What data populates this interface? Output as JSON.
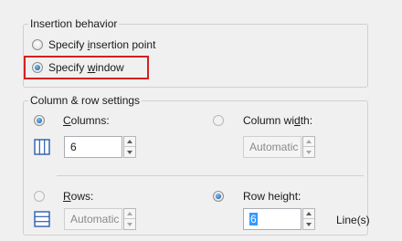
{
  "insertion_behavior": {
    "title": "Insertion behavior",
    "options": [
      {
        "label_pre": "Specify ",
        "label_u": "i",
        "label_post": "nsertion point",
        "checked": false
      },
      {
        "label_pre": "Specify ",
        "label_u": "w",
        "label_post": "indow",
        "checked": true
      }
    ]
  },
  "column_row": {
    "title": "Column & row settings",
    "columns": {
      "label_u": "C",
      "label_post": "olumns:",
      "value": "6",
      "checked": true
    },
    "column_width": {
      "label_pre": "Column wi",
      "label_u": "d",
      "label_post": "th:",
      "value": "Automatic",
      "checked": false
    },
    "rows": {
      "label_u": "R",
      "label_post": "ows:",
      "value": "Automatic",
      "checked": false
    },
    "row_height": {
      "label_pre": "Row hei",
      "label_u": "g",
      "label_post": "ht:",
      "value": "6",
      "unit": "Line(s)",
      "checked": true
    }
  },
  "colors": {
    "highlight": "#d62020",
    "accent": "#2f73b9",
    "selection": "#3399ff"
  },
  "icons": [
    "columns-icon",
    "rows-icon"
  ]
}
